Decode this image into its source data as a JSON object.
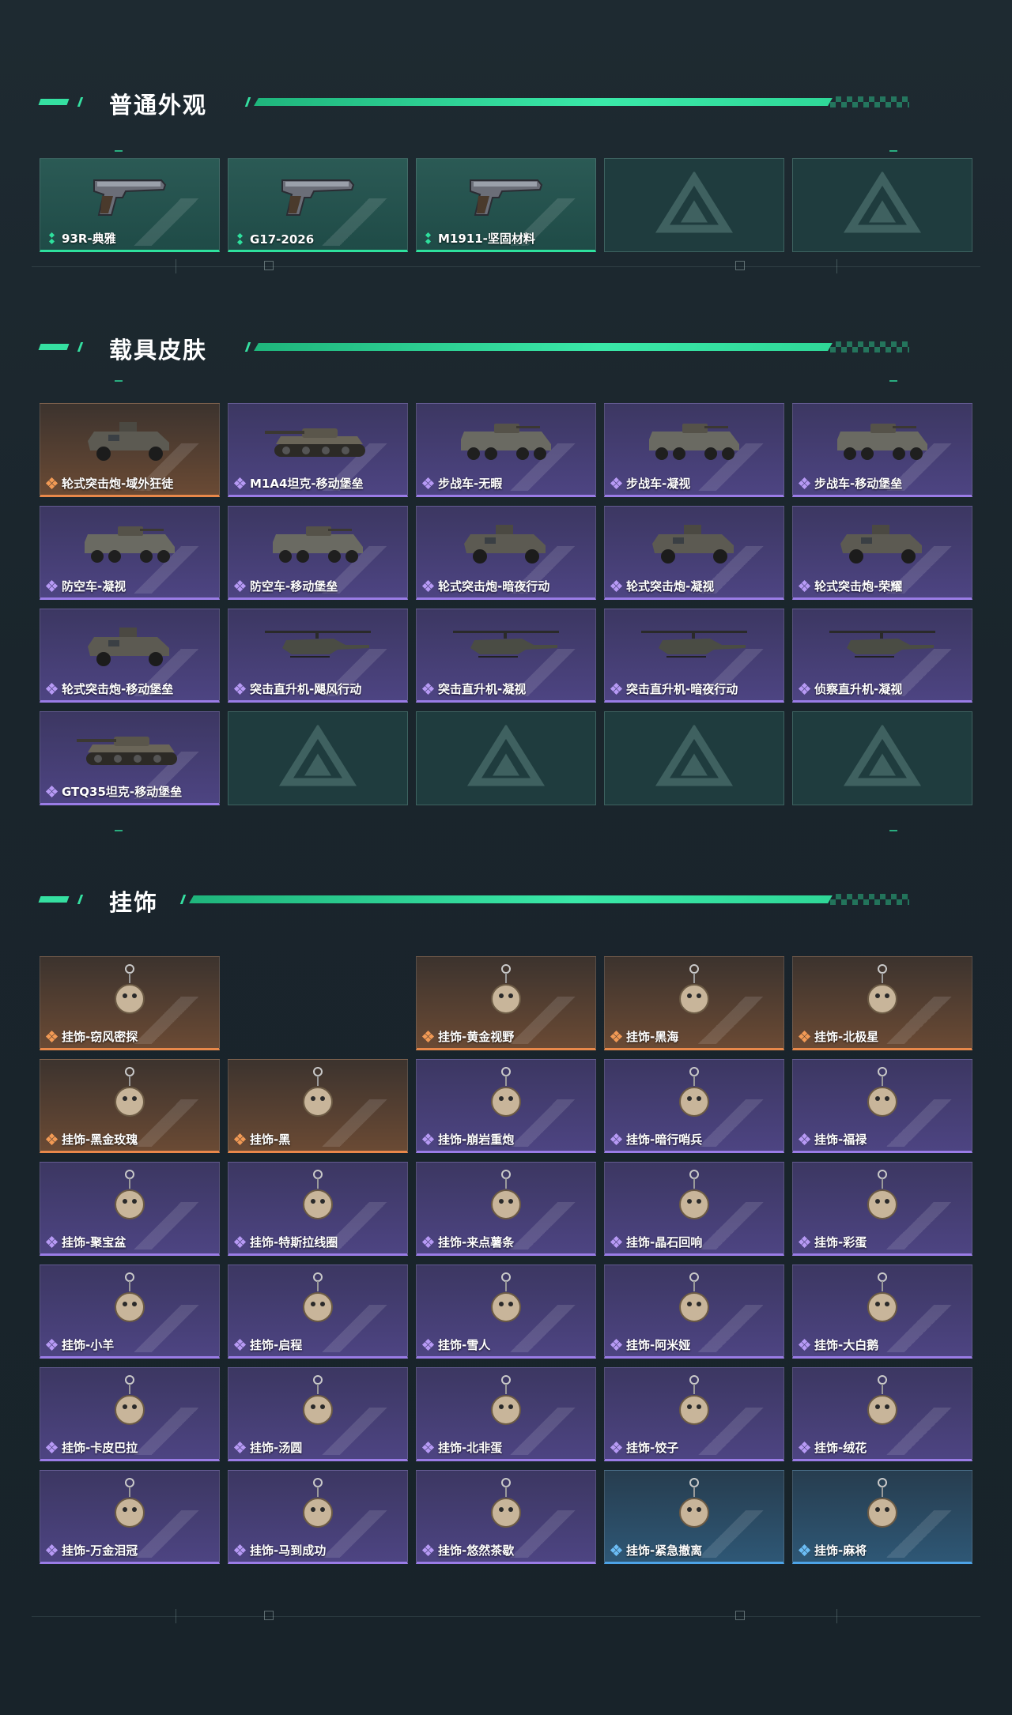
{
  "sections": [
    {
      "title": "普通外观",
      "items": [
        {
          "label": "93R-典雅",
          "rarity": "green",
          "icon": "pistol-icon"
        },
        {
          "label": "G17-2026",
          "rarity": "green",
          "icon": "pistol-icon"
        },
        {
          "label": "M1911-坚固材料",
          "rarity": "green",
          "icon": "pistol-icon"
        },
        {
          "label": "",
          "rarity": "empty",
          "icon": "delta-logo-icon"
        },
        {
          "label": "",
          "rarity": "empty",
          "icon": "delta-logo-icon"
        }
      ]
    },
    {
      "title": "载具皮肤",
      "items": [
        {
          "label": "轮式突击炮-域外狂徒",
          "rarity": "orange",
          "icon": "armored-car-icon"
        },
        {
          "label": "M1A4坦克-移动堡垒",
          "rarity": "purple",
          "icon": "tank-icon"
        },
        {
          "label": "步战车-无暇",
          "rarity": "purple",
          "icon": "ifv-icon"
        },
        {
          "label": "步战车-凝视",
          "rarity": "purple",
          "icon": "ifv-icon"
        },
        {
          "label": "步战车-移动堡垒",
          "rarity": "purple",
          "icon": "ifv-icon"
        },
        {
          "label": "防空车-凝视",
          "rarity": "purple",
          "icon": "ifv-icon"
        },
        {
          "label": "防空车-移动堡垒",
          "rarity": "purple",
          "icon": "ifv-icon"
        },
        {
          "label": "轮式突击炮-暗夜行动",
          "rarity": "purple",
          "icon": "armored-car-icon"
        },
        {
          "label": "轮式突击炮-凝视",
          "rarity": "purple",
          "icon": "armored-car-icon"
        },
        {
          "label": "轮式突击炮-荣耀",
          "rarity": "purple",
          "icon": "armored-car-icon"
        },
        {
          "label": "轮式突击炮-移动堡垒",
          "rarity": "purple",
          "icon": "armored-car-icon"
        },
        {
          "label": "突击直升机-飓风行动",
          "rarity": "purple",
          "icon": "helicopter-icon"
        },
        {
          "label": "突击直升机-凝视",
          "rarity": "purple",
          "icon": "helicopter-icon"
        },
        {
          "label": "突击直升机-暗夜行动",
          "rarity": "purple",
          "icon": "helicopter-icon"
        },
        {
          "label": "侦察直升机-凝视",
          "rarity": "purple",
          "icon": "helicopter-icon"
        },
        {
          "label": "GTQ35坦克-移动堡垒",
          "rarity": "purple",
          "icon": "tank-icon"
        },
        {
          "label": "",
          "rarity": "empty",
          "icon": "delta-logo-icon"
        },
        {
          "label": "",
          "rarity": "empty",
          "icon": "delta-logo-icon"
        },
        {
          "label": "",
          "rarity": "empty",
          "icon": "delta-logo-icon"
        },
        {
          "label": "",
          "rarity": "empty",
          "icon": "delta-logo-icon"
        }
      ]
    },
    {
      "title": "挂饰",
      "items": [
        {
          "label": "挂饰-窃风密探",
          "rarity": "orange",
          "icon": "charm-icon"
        },
        {
          "label": "",
          "rarity": "none",
          "icon": ""
        },
        {
          "label": "挂饰-黄金视野",
          "rarity": "orange",
          "icon": "charm-icon"
        },
        {
          "label": "挂饰-黑海",
          "rarity": "orange",
          "icon": "charm-icon"
        },
        {
          "label": "挂饰-北极星",
          "rarity": "orange",
          "icon": "charm-icon"
        },
        {
          "label": "挂饰-黑金玫瑰",
          "rarity": "orange",
          "icon": "charm-icon"
        },
        {
          "label": "挂饰-黑",
          "rarity": "orange",
          "icon": "charm-icon"
        },
        {
          "label": "挂饰-崩岩重炮",
          "rarity": "purple",
          "icon": "charm-icon"
        },
        {
          "label": "挂饰-暗行哨兵",
          "rarity": "purple",
          "icon": "charm-icon"
        },
        {
          "label": "挂饰-福禄",
          "rarity": "purple",
          "icon": "charm-icon"
        },
        {
          "label": "挂饰-聚宝盆",
          "rarity": "purple",
          "icon": "charm-icon"
        },
        {
          "label": "挂饰-特斯拉线圈",
          "rarity": "purple",
          "icon": "charm-icon"
        },
        {
          "label": "挂饰-来点薯条",
          "rarity": "purple",
          "icon": "charm-icon"
        },
        {
          "label": "挂饰-晶石回响",
          "rarity": "purple",
          "icon": "charm-icon"
        },
        {
          "label": "挂饰-彩蛋",
          "rarity": "purple",
          "icon": "charm-icon"
        },
        {
          "label": "挂饰-小羊",
          "rarity": "purple",
          "icon": "charm-icon"
        },
        {
          "label": "挂饰-启程",
          "rarity": "purple",
          "icon": "charm-icon"
        },
        {
          "label": "挂饰-雪人",
          "rarity": "purple",
          "icon": "charm-icon"
        },
        {
          "label": "挂饰-阿米娅",
          "rarity": "purple",
          "icon": "charm-icon"
        },
        {
          "label": "挂饰-大白鹅",
          "rarity": "purple",
          "icon": "charm-icon"
        },
        {
          "label": "挂饰-卡皮巴拉",
          "rarity": "purple",
          "icon": "charm-icon"
        },
        {
          "label": "挂饰-汤圆",
          "rarity": "purple",
          "icon": "charm-icon"
        },
        {
          "label": "挂饰-北非蛋",
          "rarity": "purple",
          "icon": "charm-icon"
        },
        {
          "label": "挂饰-饺子",
          "rarity": "purple",
          "icon": "charm-icon"
        },
        {
          "label": "挂饰-绒花",
          "rarity": "purple",
          "icon": "charm-icon"
        },
        {
          "label": "挂饰-万金泪冠",
          "rarity": "purple",
          "icon": "charm-icon"
        },
        {
          "label": "挂饰-马到成功",
          "rarity": "purple",
          "icon": "charm-icon"
        },
        {
          "label": "挂饰-悠然茶歇",
          "rarity": "purple",
          "icon": "charm-icon"
        },
        {
          "label": "挂饰-紧急撤离",
          "rarity": "blue",
          "icon": "charm-icon"
        },
        {
          "label": "挂饰-麻将",
          "rarity": "blue",
          "icon": "charm-icon"
        }
      ]
    }
  ],
  "colors": {
    "accent": "#35e0a1",
    "green": "#2ee09d",
    "purple": "#9a7ce6",
    "orange": "#e8884a",
    "blue": "#4da3e6"
  }
}
